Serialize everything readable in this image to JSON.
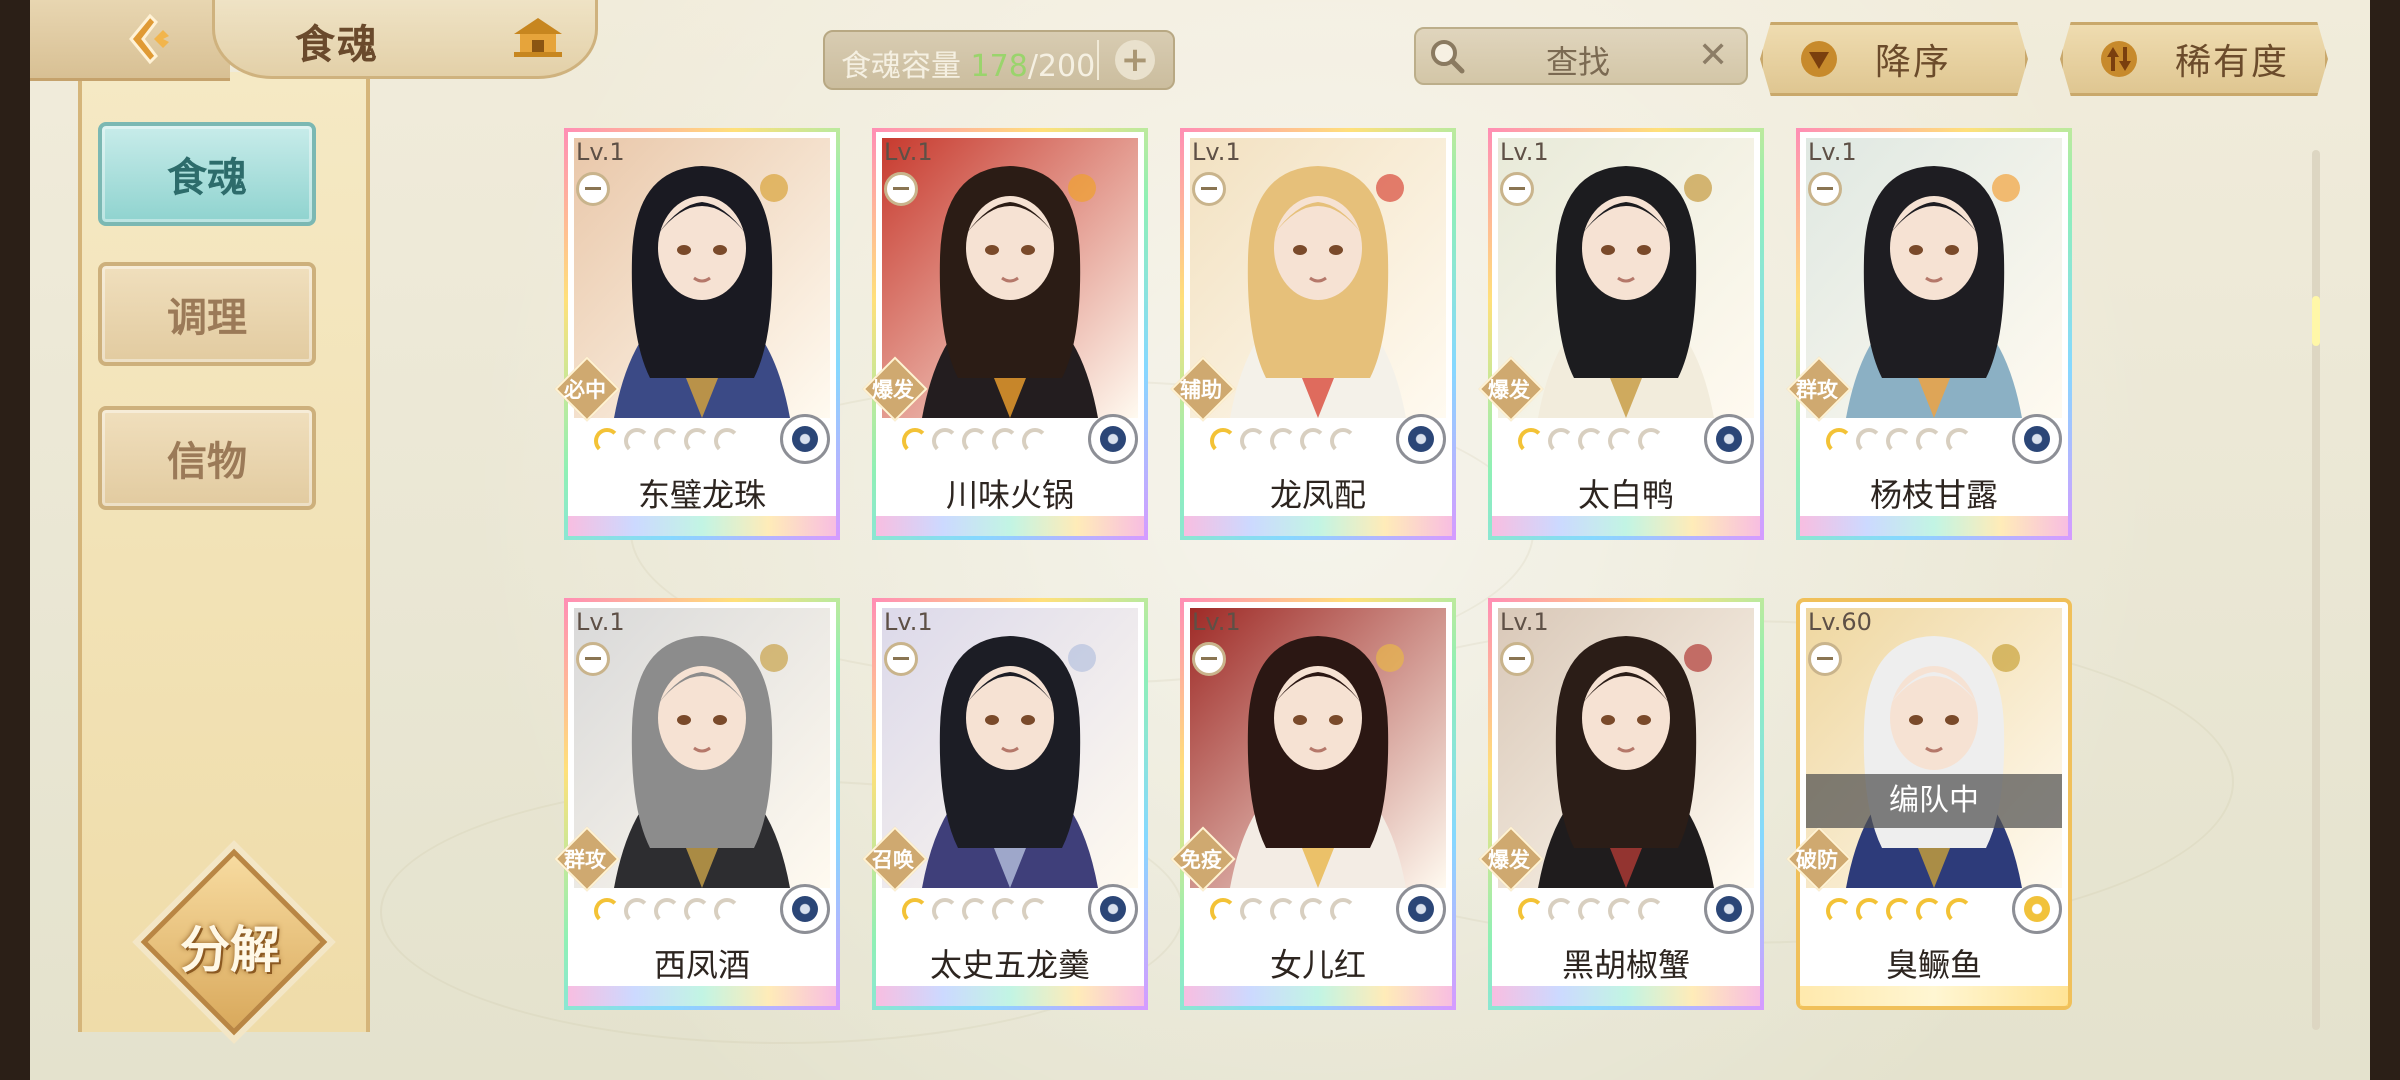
{
  "header": {
    "title": "食魂",
    "capacity": {
      "label": "食魂容量",
      "current": "178",
      "separator": "/",
      "max": "200",
      "add_label": "+"
    },
    "search": {
      "placeholder": "查找",
      "clear_label": "✕"
    },
    "sort_order_label": "降序",
    "sort_rarity_label": "稀有度"
  },
  "sidebar": {
    "tabs": [
      {
        "label": "食魂",
        "active": true
      },
      {
        "label": "调理",
        "active": false
      },
      {
        "label": "信物",
        "active": false
      }
    ],
    "decompose_label": "分解"
  },
  "cards": [
    {
      "level": "Lv.1",
      "role": "必中",
      "name": "东璧龙珠",
      "stars_filled": 1,
      "stars_total": 5,
      "element": "blue-flower-icon",
      "colors": {
        "bg": "#e9c7a9",
        "hair": "#1a1a22",
        "robe": "#3b4a86",
        "accent": "#d9a43a"
      }
    },
    {
      "level": "Lv.1",
      "role": "爆发",
      "name": "川味火锅",
      "stars_filled": 1,
      "stars_total": 5,
      "element": "blue-flower-icon",
      "colors": {
        "bg": "#c73a2e",
        "hair": "#2b1c15",
        "robe": "#231d1f",
        "accent": "#f0a12d"
      }
    },
    {
      "level": "Lv.1",
      "role": "辅助",
      "name": "龙凤配",
      "stars_filled": 1,
      "stars_total": 5,
      "element": "blue-flower-icon",
      "colors": {
        "bg": "#f2e1c1",
        "hair": "#e6c07a",
        "robe": "#f4f1e9",
        "accent": "#d94a3a"
      }
    },
    {
      "level": "Lv.1",
      "role": "爆发",
      "name": "太白鸭",
      "stars_filled": 1,
      "stars_total": 5,
      "element": "blue-flower-icon",
      "colors": {
        "bg": "#e8ead9",
        "hair": "#1c1c1f",
        "robe": "#f2ecdc",
        "accent": "#c59a3f"
      }
    },
    {
      "level": "Lv.1",
      "role": "群攻",
      "name": "杨枝甘露",
      "stars_filled": 1,
      "stars_total": 5,
      "element": "blue-flower-icon",
      "colors": {
        "bg": "#dfe8e2",
        "hair": "#1e1d22",
        "robe": "#8bb0c4",
        "accent": "#f2a23c"
      }
    },
    {
      "level": "Lv.1",
      "role": "群攻",
      "name": "西凤酒",
      "stars_filled": 1,
      "stars_total": 5,
      "element": "blue-flower-icon",
      "colors": {
        "bg": "#d9d9d9",
        "hair": "#8c8c8c",
        "robe": "#2d2d30",
        "accent": "#c9a24a"
      }
    },
    {
      "level": "Lv.1",
      "role": "召唤",
      "name": "太史五龙羹",
      "stars_filled": 1,
      "stars_total": 5,
      "element": "blue-flower-icon",
      "colors": {
        "bg": "#dcd9ea",
        "hair": "#1c1d25",
        "robe": "#3f3f7a",
        "accent": "#b6c2de"
      }
    },
    {
      "level": "Lv.1",
      "role": "免疫",
      "name": "女儿红",
      "stars_filled": 1,
      "stars_total": 5,
      "element": "blue-flower-icon",
      "colors": {
        "bg": "#9e2a26",
        "hair": "#2b1713",
        "robe": "#f3ece4",
        "accent": "#e8b64a"
      }
    },
    {
      "level": "Lv.1",
      "role": "爆发",
      "name": "黑胡椒蟹",
      "stars_filled": 1,
      "stars_total": 5,
      "element": "blue-flower-icon",
      "colors": {
        "bg": "#d9c8b8",
        "hair": "#2b1d17",
        "robe": "#1f1c1d",
        "accent": "#b03b36"
      }
    },
    {
      "level": "Lv.60",
      "role": "破防",
      "name": "臭鳜鱼",
      "stars_filled": 5,
      "stars_total": 5,
      "element": "gold-flower-icon",
      "team_status": "编队中",
      "colors": {
        "bg": "#efd7a0",
        "hair": "#eeeeee",
        "robe": "#2d3b7a",
        "accent": "#c9a23a"
      }
    }
  ]
}
